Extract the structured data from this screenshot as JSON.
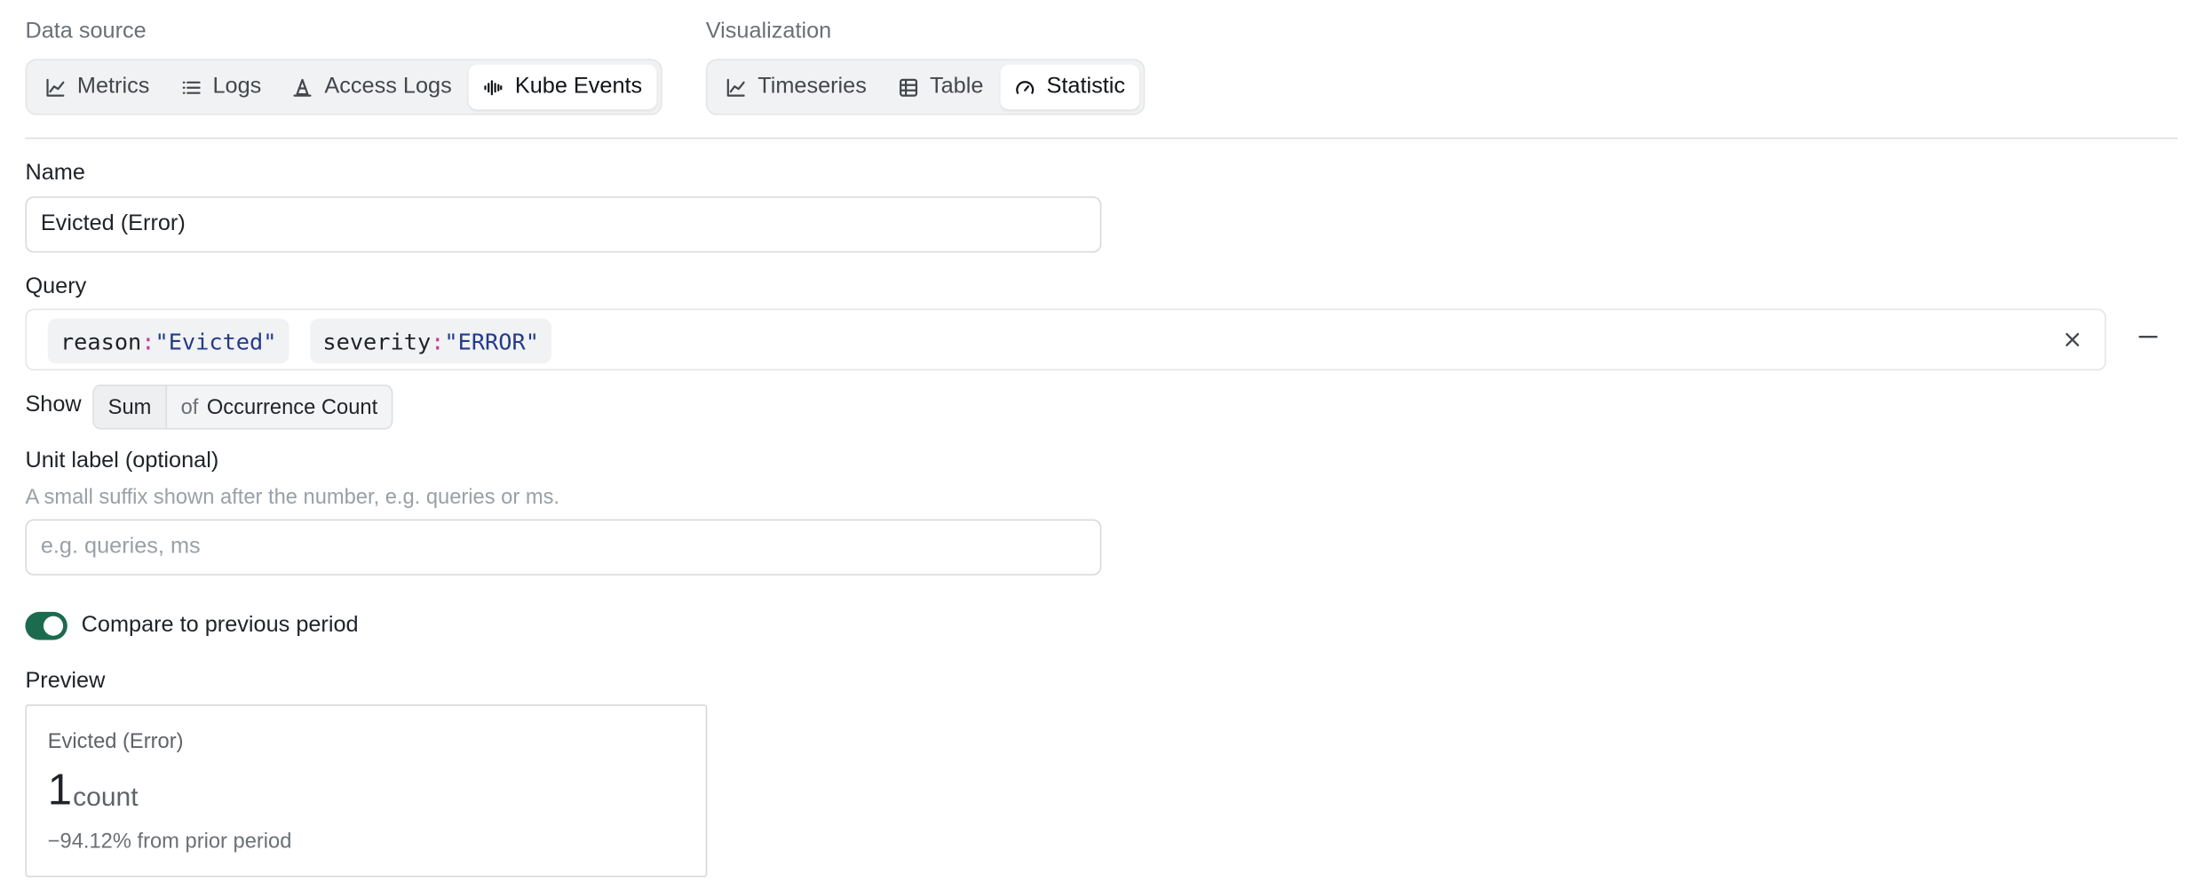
{
  "data_source": {
    "label": "Data source",
    "options": [
      {
        "label": "Metrics",
        "icon": "line-chart-icon",
        "active": false
      },
      {
        "label": "Logs",
        "icon": "list-icon",
        "active": false
      },
      {
        "label": "Access Logs",
        "icon": "cone-icon",
        "active": false
      },
      {
        "label": "Kube Events",
        "icon": "waveform-icon",
        "active": true
      }
    ]
  },
  "visualization": {
    "label": "Visualization",
    "options": [
      {
        "label": "Timeseries",
        "icon": "line-chart-icon",
        "active": false
      },
      {
        "label": "Table",
        "icon": "table-icon",
        "active": false
      },
      {
        "label": "Statistic",
        "icon": "gauge-icon",
        "active": true
      }
    ]
  },
  "name": {
    "label": "Name",
    "value": "Evicted (Error)"
  },
  "query": {
    "label": "Query",
    "filters": [
      {
        "key": "reason",
        "sep": ":",
        "value": "\"Evicted\""
      },
      {
        "key": "severity",
        "sep": ":",
        "value": "\"ERROR\""
      }
    ]
  },
  "show": {
    "label": "Show",
    "function": "Sum",
    "of": "of",
    "field": "Occurrence Count"
  },
  "unit": {
    "label": "Unit label (optional)",
    "hint": "A small suffix shown after the number, e.g. queries or ms.",
    "value": "",
    "placeholder": "e.g. queries, ms"
  },
  "compare": {
    "label": "Compare to previous period",
    "enabled": true
  },
  "preview": {
    "label": "Preview",
    "title": "Evicted (Error)",
    "value": "1",
    "unit": "count",
    "delta": "−94.12% from prior period"
  },
  "colors": {
    "toggle_on": "#1c6b4e",
    "query_value": "#243b8a",
    "query_colon": "#c2399f"
  }
}
